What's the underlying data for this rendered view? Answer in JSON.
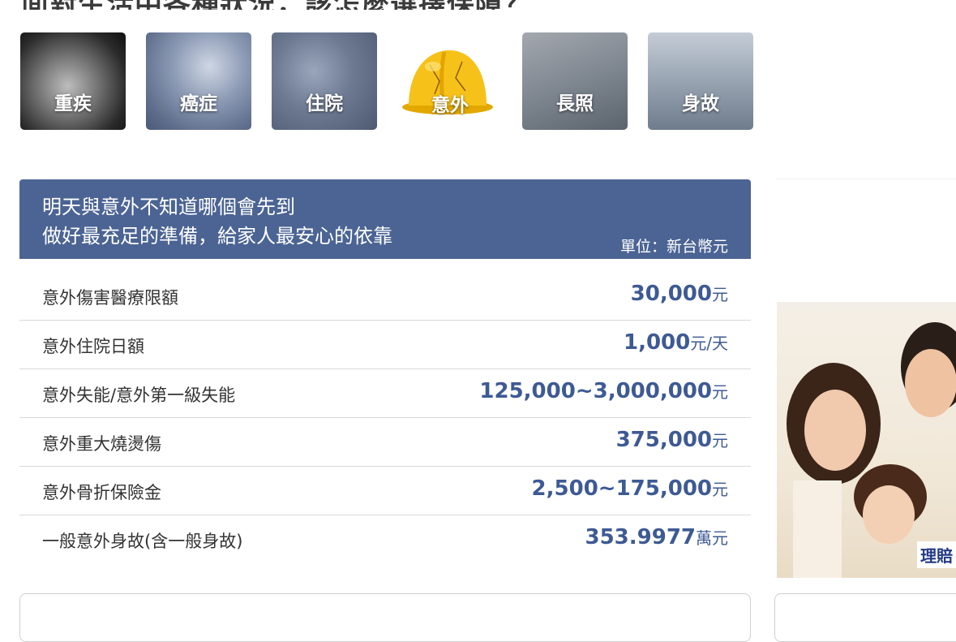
{
  "heading": "面對生活中各種狀況，該怎麼選擇保障？",
  "categories": [
    {
      "label": "重疾",
      "icon": "heart-photo-icon"
    },
    {
      "label": "癌症",
      "icon": "cells-photo-icon"
    },
    {
      "label": "住院",
      "icon": "teddy-bear-photo-icon"
    },
    {
      "label": "意外",
      "icon": "hard-hat-icon",
      "active": true
    },
    {
      "label": "長照",
      "icon": "hands-photo-icon"
    },
    {
      "label": "身故",
      "icon": "family-hands-photo-icon"
    }
  ],
  "card": {
    "line1": "明天與意外不知道哪個會先到",
    "line2": "做好最充足的準備，給家人最安心的依靠",
    "unit": "單位：新台幣元"
  },
  "rows": [
    {
      "name": "意外傷害醫療限額",
      "amount": "30,000",
      "unit": "元"
    },
    {
      "name": "意外住院日額",
      "amount": "1,000",
      "unit": "元/天"
    },
    {
      "name": "意外失能/意外第一級失能",
      "amount": "125,000~3,000,000",
      "unit": "元"
    },
    {
      "name": "意外重大燒燙傷",
      "amount": "375,000",
      "unit": "元"
    },
    {
      "name": "意外骨折保險金",
      "amount": "2,500~175,000",
      "unit": "元"
    },
    {
      "name": "一般意外身故(含一般身故)",
      "amount": "353.9977",
      "unit": "萬元"
    }
  ],
  "side": {
    "badge": "理賠"
  },
  "colors": {
    "header_bg": "#4b6494",
    "value_text": "#3e5a94"
  }
}
